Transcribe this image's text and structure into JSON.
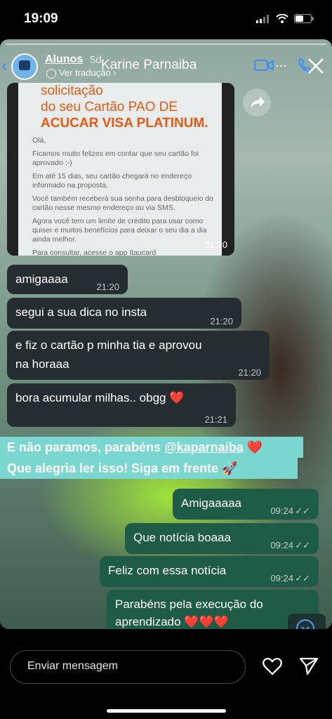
{
  "status_bar": {
    "time": "19:09"
  },
  "story_header": {
    "username": "Alunos",
    "age": "5d",
    "translate_label": "Ver tradução",
    "chat_name": "Karine Parnaiba",
    "more": "..."
  },
  "screenshot": {
    "title_line1": "solicitação",
    "title_line2": "do seu Cartão PAO DE",
    "title_line3": "ACUCAR VISA PLATINUM.",
    "body": [
      "Olá,",
      "Ficamos muito felizes em contar que seu cartão foi aprovado ;-)",
      "Em até 15 dias, seu cartão chegará no endereço informado na proposta.",
      "Você também receberá sua senha para desbloqueio do cartão nesse mesmo endereço ou via SMS.",
      "Agora você tem um limite de crédito para usar como quiser e muitos benefícios para deixar o seu dia a dia ainda melhor.",
      "Para consultar, acesse o app Itaucard"
    ],
    "time": "21:20"
  },
  "incoming_messages": [
    {
      "text": "amigaaaa",
      "time": "21:20"
    },
    {
      "text": "segui a sua dica no insta",
      "time": "21:20"
    },
    {
      "text1": "e fiz o cartão p minha tia e aprovou",
      "text2": "na horaaa",
      "time": "21:20"
    },
    {
      "text": "bora acumular milhas.. obgg ❤️",
      "time": "21:21"
    }
  ],
  "caption": {
    "line1_pre": "E não paramos, parabéns ",
    "mention": "@kaparnaiba",
    "line1_post": " ❤️",
    "line2": "Que alegria ler isso! Siga em frente 🚀"
  },
  "outgoing_messages": [
    {
      "text": "Amigaaaaa",
      "time": "09:24"
    },
    {
      "text": "Que notícia boaaa",
      "time": "09:24"
    },
    {
      "text": "Feliz com essa notícia",
      "time": "09:24"
    },
    {
      "text1": "Parabéns pela execução do",
      "text2": "aprendizado ❤️❤️❤️"
    }
  ],
  "bottom_bar": {
    "input_placeholder": "Enviar mensagem"
  },
  "icons": [
    "signal-icon",
    "wifi-icon",
    "battery-icon",
    "back-icon",
    "video-call-icon",
    "phone-icon",
    "close-icon",
    "share-icon",
    "scroll-down-icon",
    "heart-icon",
    "send-icon",
    "double-check-icon"
  ]
}
